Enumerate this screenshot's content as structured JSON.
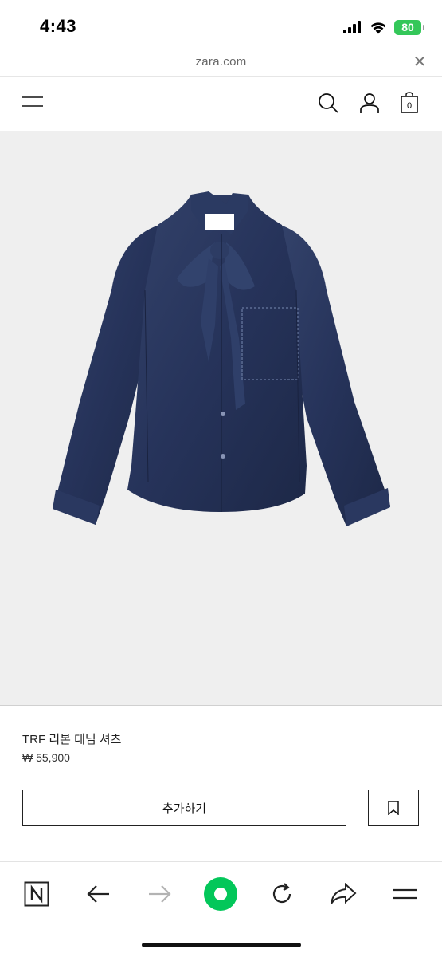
{
  "status_bar": {
    "time": "4:43",
    "battery": "80",
    "signal_icon": "cellular-signal-icon",
    "wifi_icon": "wifi-icon"
  },
  "url_bar": {
    "url": "zara.com",
    "close_icon": "close-icon"
  },
  "header": {
    "menu_icon": "hamburger-menu-icon",
    "search_icon": "search-icon",
    "account_icon": "user-icon",
    "cart_icon": "shopping-bag-icon",
    "cart_count": "0"
  },
  "product": {
    "image_label": "denim shirt with ribbon tie",
    "name": "TRF 리본 데님 셔츠",
    "price": "₩ 55,900",
    "add_label": "추가하기",
    "bookmark_icon": "bookmark-icon"
  },
  "browser_bar": {
    "items": [
      "naver-n-icon",
      "back-arrow-icon",
      "forward-arrow-icon",
      "green-dot-icon",
      "refresh-icon",
      "share-icon",
      "more-menu-icon"
    ],
    "accent": "#03c75a"
  }
}
